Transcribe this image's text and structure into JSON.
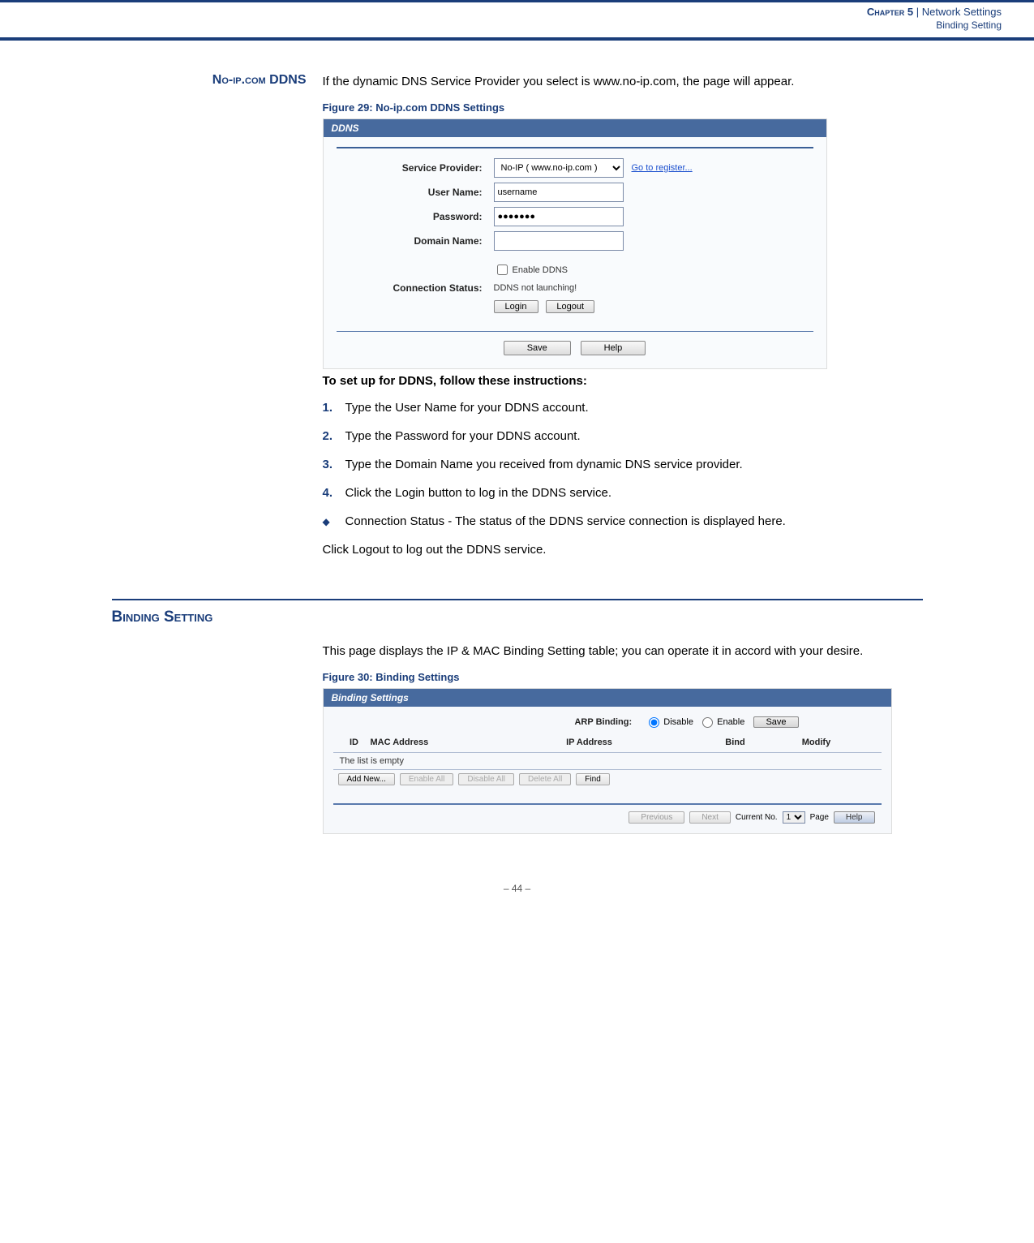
{
  "header": {
    "chapter_label": "Chapter 5",
    "separator": "  |  ",
    "chapter_title": "Network Settings",
    "subtitle": "Binding Setting"
  },
  "section1": {
    "margin_title": "No-ip.com DDNS",
    "intro": "If the dynamic DNS Service Provider you select is www.no-ip.com, the page will appear.",
    "fig_caption": "Figure 29:  No-ip.com DDNS Settings",
    "panel_title": "DDNS",
    "form": {
      "service_provider_label": "Service Provider:",
      "service_provider_value": "No-IP ( www.no-ip.com )",
      "register_link": "Go to register...",
      "user_name_label": "User Name:",
      "user_name_value": "username",
      "password_label": "Password:",
      "password_value": "●●●●●●●",
      "domain_name_label": "Domain Name:",
      "domain_name_value": "",
      "enable_label": "Enable DDNS",
      "conn_status_label": "Connection Status:",
      "conn_status_value": "DDNS not launching!",
      "login_btn": "Login",
      "logout_btn": "Logout",
      "save_btn": "Save",
      "help_btn": "Help"
    },
    "instructions_heading": "To set up for DDNS, follow these instructions:",
    "steps": {
      "n1": "1.",
      "t1": "Type the User Name for your DDNS account.",
      "n2": "2.",
      "t2": "Type the Password for your DDNS account.",
      "n3": "3.",
      "t3": "Type the Domain Name you received from dynamic DNS service provider.",
      "n4": "4.",
      "t4": "Click the Login button to log in the DDNS service."
    },
    "bullet_text": "Connection Status - The status of the DDNS service connection is displayed here.",
    "logout_line": "Click Logout to log out the DDNS service."
  },
  "section2": {
    "title": "Binding Setting",
    "intro": "This page displays the IP & MAC Binding Setting table; you can operate it in accord with your desire.",
    "fig_caption": "Figure 30:  Binding Settings",
    "panel_title": "Binding Settings",
    "arp_label": "ARP Binding:",
    "radio_disable": "Disable",
    "radio_enable": "Enable",
    "save_btn": "Save",
    "cols": {
      "id": "ID",
      "mac": "MAC Address",
      "ip": "IP Address",
      "bind": "Bind",
      "modify": "Modify"
    },
    "empty": "The list is empty",
    "btns": {
      "add": "Add New...",
      "enable_all": "Enable All",
      "disable_all": "Disable All",
      "delete_all": "Delete All",
      "find": "Find"
    },
    "pager": {
      "prev": "Previous",
      "next": "Next",
      "current_label": "Current No.",
      "current_val": "1",
      "page_label": "Page",
      "help": "Help"
    }
  },
  "footer": {
    "page_num": "–  44  –"
  }
}
